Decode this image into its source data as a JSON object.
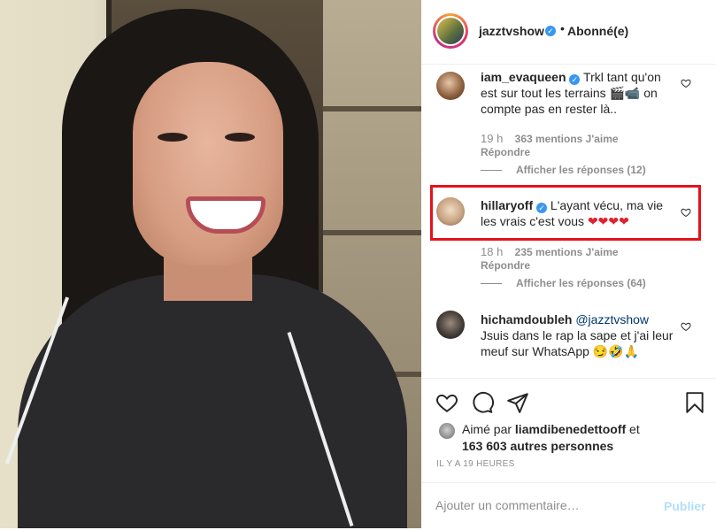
{
  "header": {
    "username": "jazztvshow",
    "dot": "•",
    "follow_status": "Abonné(e)"
  },
  "comments": [
    {
      "username": "iam_evaqueen",
      "text": "Trkl tant qu'on est sur tout les terrains 🎬📹 on compte pas en rester là..",
      "time": "19 h",
      "likes": "363 mentions J'aime",
      "reply_label": "Répondre",
      "view_replies": "Afficher les réponses (12)"
    },
    {
      "username": "hillaryoff",
      "text": "L'ayant vécu, ma vie les vrais c'est vous",
      "hearts": "❤❤❤❤",
      "time": "18 h",
      "likes": "235 mentions J'aime",
      "reply_label": "Répondre",
      "view_replies": "Afficher les réponses (64)"
    },
    {
      "username": "hichamdoubleh",
      "mention": "@jazztvshow",
      "text": "Jsuis dans le rap la sape et j'ai leur meuf sur WhatsApp 😏🤣🙏"
    }
  ],
  "likes_block": {
    "prefix": "Aimé par",
    "user": "liamdibenedettooff",
    "conjunction": "et",
    "others": "163 603 autres personnes"
  },
  "time_ago": "IL Y A 19 HEURES",
  "add_comment": {
    "placeholder": "Ajouter un commentaire…",
    "post_label": "Publier"
  },
  "colors": {
    "verified": "#3897f0",
    "highlight": "#e5121a",
    "heart_red": "#e0212f",
    "post_disabled": "#b2dffc"
  }
}
